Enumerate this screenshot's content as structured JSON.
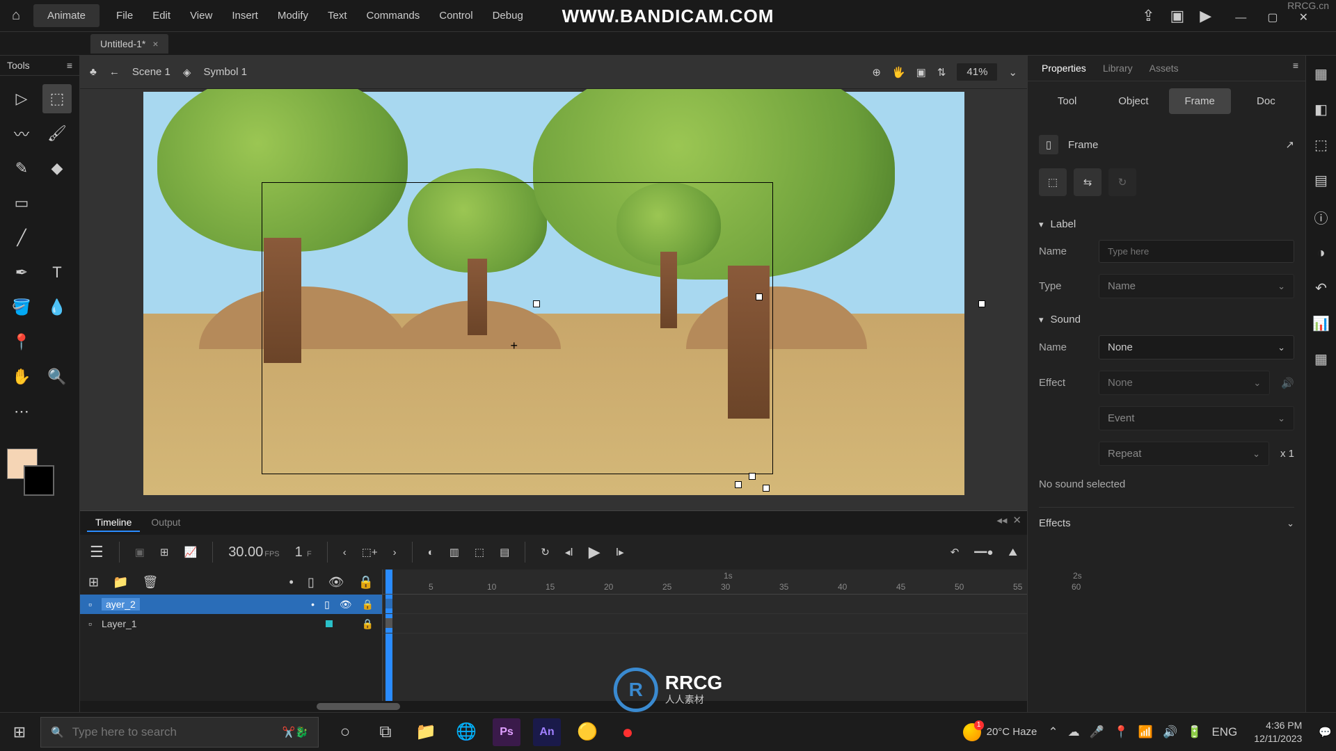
{
  "watermark": "WWW.BANDICAM.COM",
  "watermark2": "RRCG.cn",
  "app": {
    "name": "Animate"
  },
  "menu": [
    "File",
    "Edit",
    "View",
    "Insert",
    "Modify",
    "Text",
    "Commands",
    "Control",
    "Debug"
  ],
  "doc": {
    "tab": "Untitled-1*"
  },
  "scenebar": {
    "scene": "Scene 1",
    "symbol": "Symbol 1",
    "zoom": "41%"
  },
  "tools_label": "Tools",
  "timeline": {
    "tabs": [
      "Timeline",
      "Output"
    ],
    "fps": "30.00",
    "fps_label": "FPS",
    "frame": "1",
    "frame_label": "F",
    "marker_1s": "1s",
    "marker_2s": "2s",
    "ruler": [
      "5",
      "10",
      "15",
      "20",
      "25",
      "30",
      "35",
      "40",
      "45",
      "50",
      "55",
      "60"
    ],
    "layers": [
      {
        "name": "ayer_2",
        "selected": true,
        "editing": true
      },
      {
        "name": "Layer_1",
        "selected": false
      }
    ]
  },
  "properties": {
    "tabs": [
      "Properties",
      "Library",
      "Assets"
    ],
    "subtabs": [
      "Tool",
      "Object",
      "Frame",
      "Doc"
    ],
    "active_subtab": "Frame",
    "frame_title": "Frame",
    "sections": {
      "label": {
        "title": "Label",
        "name_lbl": "Name",
        "name_ph": "Type here",
        "type_lbl": "Type",
        "type_val": "Name"
      },
      "sound": {
        "title": "Sound",
        "name_lbl": "Name",
        "name_val": "None",
        "effect_lbl": "Effect",
        "effect_val": "None",
        "sync1": "Event",
        "sync2": "Repeat",
        "sync_times": "x 1",
        "status": "No sound selected"
      },
      "effects": {
        "title": "Effects"
      }
    }
  },
  "taskbar": {
    "search_ph": "Type here to search",
    "weather": "20°C Haze",
    "lang": "ENG",
    "time": "4:36 PM",
    "date": "12/11/2023"
  },
  "center_logo": {
    "main": "RRCG",
    "sub": "人人素材"
  }
}
